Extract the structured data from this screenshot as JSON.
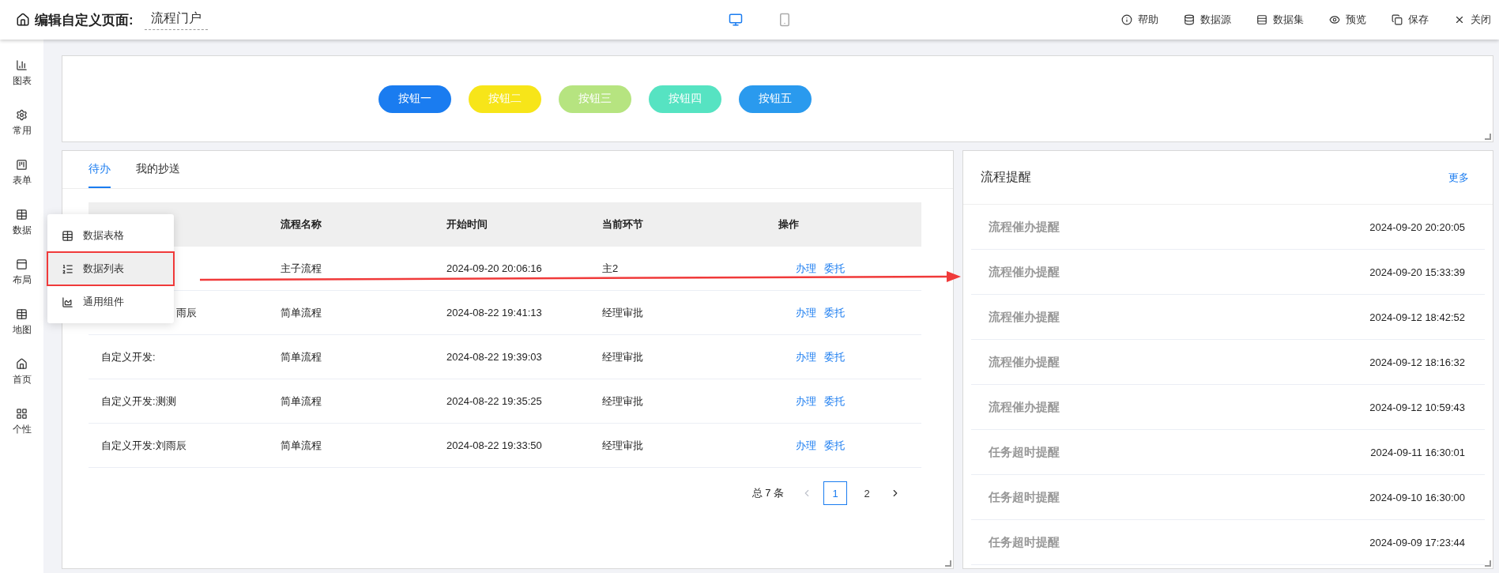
{
  "header": {
    "title": "编辑自定义页面:",
    "page_name": "流程门户",
    "devices": [
      {
        "kind": "desktop",
        "selected": true
      },
      {
        "kind": "mobile",
        "selected": false
      }
    ],
    "actions": [
      {
        "kind": "help",
        "label": "帮助"
      },
      {
        "kind": "datasource",
        "label": "数据源"
      },
      {
        "kind": "dataset",
        "label": "数据集"
      },
      {
        "kind": "preview",
        "label": "预览"
      },
      {
        "kind": "save",
        "label": "保存"
      },
      {
        "kind": "close",
        "label": "关闭"
      }
    ]
  },
  "sidebar": {
    "items": [
      {
        "kind": "chart",
        "label": "图表"
      },
      {
        "kind": "common",
        "label": "常用"
      },
      {
        "kind": "form",
        "label": "表单"
      },
      {
        "kind": "data",
        "label": "数据"
      },
      {
        "kind": "layout",
        "label": "布局"
      },
      {
        "kind": "map",
        "label": "地图"
      },
      {
        "kind": "home",
        "label": "首页"
      },
      {
        "kind": "custom",
        "label": "个性"
      }
    ]
  },
  "popup_menu": {
    "items": [
      {
        "kind": "table",
        "label": "数据表格",
        "selected": false
      },
      {
        "kind": "list",
        "label": "数据列表",
        "selected": true
      },
      {
        "kind": "chart",
        "label": "通用组件",
        "selected": false
      }
    ]
  },
  "button_panel": {
    "buttons": [
      {
        "label": "按钮一",
        "color": "#1a7cf0"
      },
      {
        "label": "按钮二",
        "color": "#f7e519"
      },
      {
        "label": "按钮三",
        "color": "#b6e480"
      },
      {
        "label": "按钮四",
        "color": "#56e3c2"
      },
      {
        "label": "按钮五",
        "color": "#2a9aee"
      }
    ]
  },
  "todo_panel": {
    "tabs": [
      {
        "label": "待办",
        "selected": true
      },
      {
        "label": "我的抄送",
        "selected": false
      }
    ],
    "columns": [
      "流程名称",
      "开始时间",
      "当前环节",
      "操作"
    ],
    "rows": [
      {
        "process": "主子流程",
        "start": "2024-09-20 20:06:16",
        "node": "主2",
        "actions": [
          "办理",
          "委托"
        ]
      },
      {
        "name": "雨辰",
        "clipped": true,
        "process": "简单流程",
        "start": "2024-08-22 19:41:13",
        "node": "经理审批",
        "actions": [
          "办理",
          "委托"
        ]
      },
      {
        "name": "自定义开发:",
        "clipped": false,
        "process": "简单流程",
        "start": "2024-08-22 19:39:03",
        "node": "经理审批",
        "actions": [
          "办理",
          "委托"
        ]
      },
      {
        "name": "自定义开发:测测",
        "clipped": false,
        "process": "简单流程",
        "start": "2024-08-22 19:35:25",
        "node": "经理审批",
        "actions": [
          "办理",
          "委托"
        ]
      },
      {
        "name": "自定义开发:刘雨辰",
        "clipped": false,
        "process": "简单流程",
        "start": "2024-08-22 19:33:50",
        "node": "经理审批",
        "actions": [
          "办理",
          "委托"
        ]
      }
    ],
    "pagination": {
      "total": "总 7 条",
      "prev_disabled": true,
      "next_disabled": false,
      "pages": [
        {
          "label": "1",
          "selected": true
        },
        {
          "label": "2",
          "selected": false
        }
      ]
    }
  },
  "reminder_panel": {
    "title": "流程提醒",
    "more": "更多",
    "items": [
      {
        "title": "流程催办提醒",
        "time": "2024-09-20 20:20:05"
      },
      {
        "title": "流程催办提醒",
        "time": "2024-09-20 15:33:39"
      },
      {
        "title": "流程催办提醒",
        "time": "2024-09-12 18:42:52"
      },
      {
        "title": "流程催办提醒",
        "time": "2024-09-12 18:16:32"
      },
      {
        "title": "流程催办提醒",
        "time": "2024-09-12 10:59:43"
      },
      {
        "title": "任务超时提醒",
        "time": "2024-09-11 16:30:01"
      },
      {
        "title": "任务超时提醒",
        "time": "2024-09-10 16:30:00"
      },
      {
        "title": "任务超时提醒",
        "time": "2024-09-09 17:23:44"
      }
    ]
  }
}
